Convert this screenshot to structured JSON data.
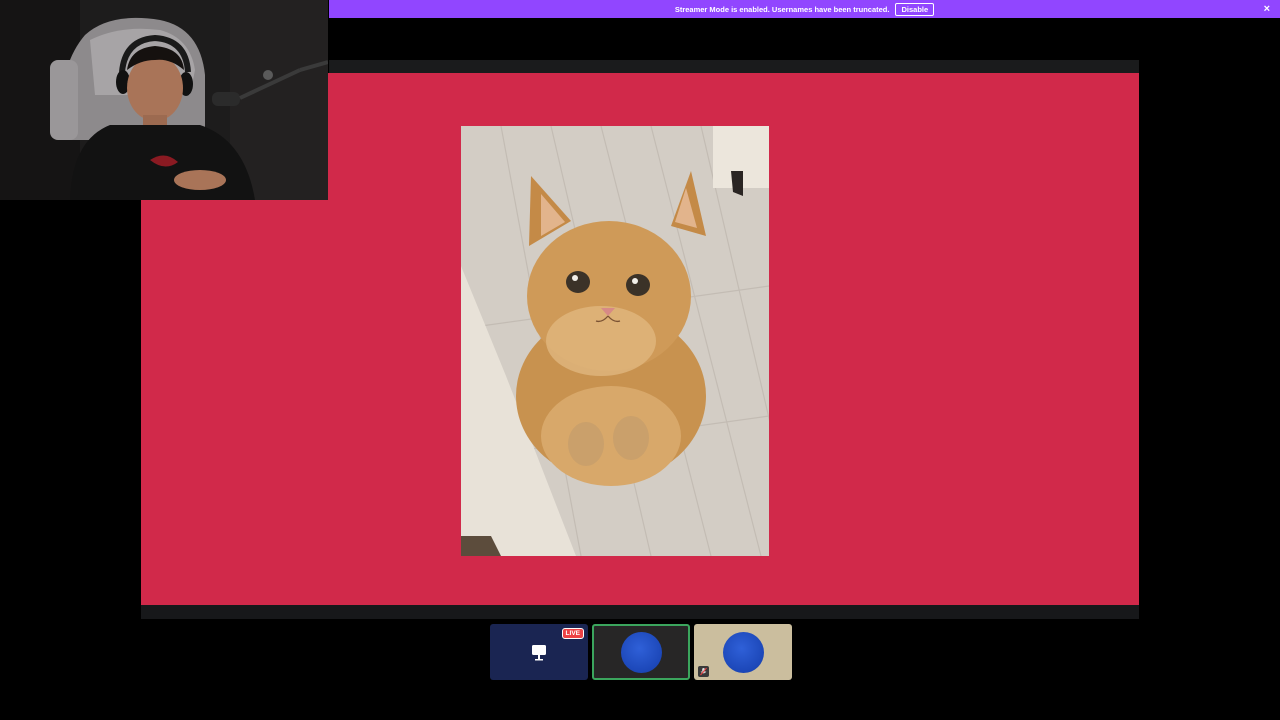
{
  "notice": {
    "text": "Streamer Mode is enabled. Usernames have been truncated.",
    "disable_label": "Disable",
    "close_glyph": "×"
  },
  "stage": {
    "background": "#d1294a",
    "image_subject": "orange-kitten-photo"
  },
  "tiles": [
    {
      "kind": "screen-share",
      "badge": "LIVE",
      "icon": "screen-share-icon"
    },
    {
      "kind": "participant",
      "state": "speaking",
      "avatar": "blue-avatar"
    },
    {
      "kind": "participant",
      "state": "muted",
      "avatar": "blue-avatar",
      "icon": "mic-muted-icon"
    }
  ],
  "colors": {
    "notice_bar": "#9146ff",
    "live_badge": "#ed4245",
    "speaking_ring": "#3ba55d"
  }
}
